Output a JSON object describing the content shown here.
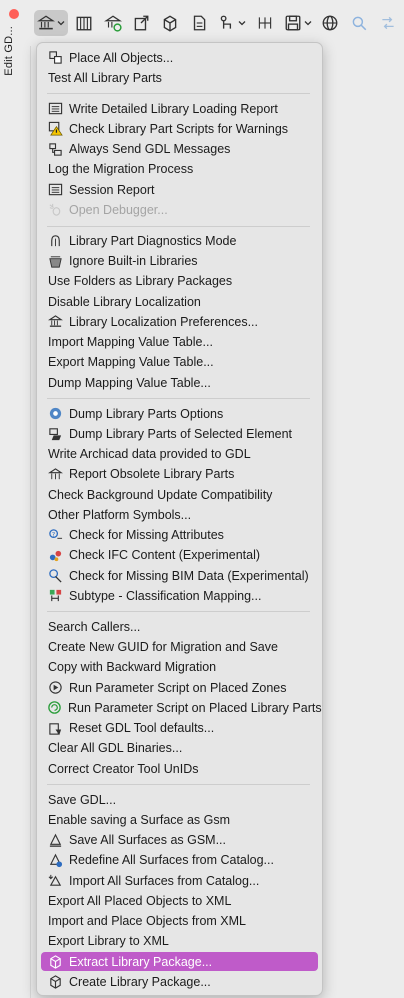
{
  "window": {
    "title": "Edit GD..."
  },
  "toolbar": {
    "buttons": [
      {
        "icon": "library-building-icon",
        "dropdown": true,
        "active": true
      },
      {
        "icon": "library-icon"
      },
      {
        "icon": "library-refresh-icon"
      },
      {
        "icon": "library-export-icon"
      },
      {
        "icon": "library-package-icon"
      },
      {
        "icon": "library-document-icon"
      },
      {
        "icon": "hierarchy-icon",
        "dropdown": true
      },
      {
        "icon": "columns-icon"
      },
      {
        "icon": "save-icon",
        "dropdown": true
      },
      {
        "icon": "globe-icon"
      },
      {
        "icon": "search-icon",
        "disabled": true
      },
      {
        "icon": "compare-icon",
        "disabled": true
      }
    ]
  },
  "menu": {
    "highlight_color": "#bf5bc9",
    "items": [
      {
        "label": "Place All Objects...",
        "icon": "place-objects-icon"
      },
      {
        "label": "Test All Library Parts"
      },
      {
        "sep": true
      },
      {
        "label": "Write Detailed Library Loading Report",
        "icon": "report-icon"
      },
      {
        "label": "Check Library Part Scripts for Warnings",
        "icon": "warning-icon"
      },
      {
        "label": "Always Send GDL Messages",
        "icon": "messages-icon"
      },
      {
        "label": "Log the Migration Process"
      },
      {
        "label": "Session Report",
        "icon": "report-icon"
      },
      {
        "label": "Open Debugger...",
        "icon": "bug-icon",
        "disabled": true
      },
      {
        "sep": true
      },
      {
        "label": "Library Part Diagnostics Mode",
        "icon": "diagnostics-icon"
      },
      {
        "label": "Ignore Built-in Libraries",
        "icon": "ignore-library-icon"
      },
      {
        "label": "Use Folders as Library Packages"
      },
      {
        "label": "Disable Library Localization"
      },
      {
        "label": "Library Localization Preferences...",
        "icon": "library-building-icon"
      },
      {
        "label": "Import Mapping Value Table..."
      },
      {
        "label": "Export Mapping Value Table..."
      },
      {
        "label": "Dump Mapping Value Table..."
      },
      {
        "sep": true
      },
      {
        "label": "Dump Library Parts Options",
        "icon": "dump-options-icon"
      },
      {
        "label": "Dump Library Parts of Selected Element",
        "icon": "dump-selected-icon"
      },
      {
        "label": "Write Archicad data provided to GDL"
      },
      {
        "label": "Report Obsolete Library Parts",
        "icon": "obsolete-icon"
      },
      {
        "label": "Check Background Update Compatibility"
      },
      {
        "label": "Other Platform Symbols..."
      },
      {
        "label": "Check for Missing Attributes",
        "icon": "missing-attributes-icon"
      },
      {
        "label": "Check IFC Content (Experimental)",
        "icon": "ifc-icon"
      },
      {
        "label": "Check for Missing BIM Data (Experimental)",
        "icon": "bim-data-icon"
      },
      {
        "label": "Subtype - Classification Mapping...",
        "icon": "classification-icon"
      },
      {
        "sep": true
      },
      {
        "label": "Search Callers..."
      },
      {
        "label": "Create New GUID for Migration and Save"
      },
      {
        "label": "Copy with Backward Migration"
      },
      {
        "label": "Run Parameter Script on Placed Zones",
        "icon": "run-zones-icon"
      },
      {
        "label": "Run Parameter Script on Placed Library Parts",
        "icon": "run-parts-icon"
      },
      {
        "label": "Reset GDL Tool defaults...",
        "icon": "reset-icon"
      },
      {
        "label": "Clear All GDL Binaries..."
      },
      {
        "label": "Correct Creator Tool UnIDs"
      },
      {
        "sep": true
      },
      {
        "label": "Save GDL..."
      },
      {
        "label": "Enable saving a Surface as Gsm"
      },
      {
        "label": "Save All Surfaces as GSM...",
        "icon": "surface-save-icon"
      },
      {
        "label": "Redefine All Surfaces from Catalog...",
        "icon": "surface-redefine-icon"
      },
      {
        "label": "Import All Surfaces from Catalog...",
        "icon": "surface-import-icon"
      },
      {
        "label": "Export All Placed Objects to XML"
      },
      {
        "label": "Import and Place Objects from XML"
      },
      {
        "label": "Export Library to XML"
      },
      {
        "label": "Extract Library Package...",
        "icon": "package-extract-icon",
        "highlighted": true
      },
      {
        "label": "Create Library Package...",
        "icon": "package-create-icon"
      }
    ]
  }
}
